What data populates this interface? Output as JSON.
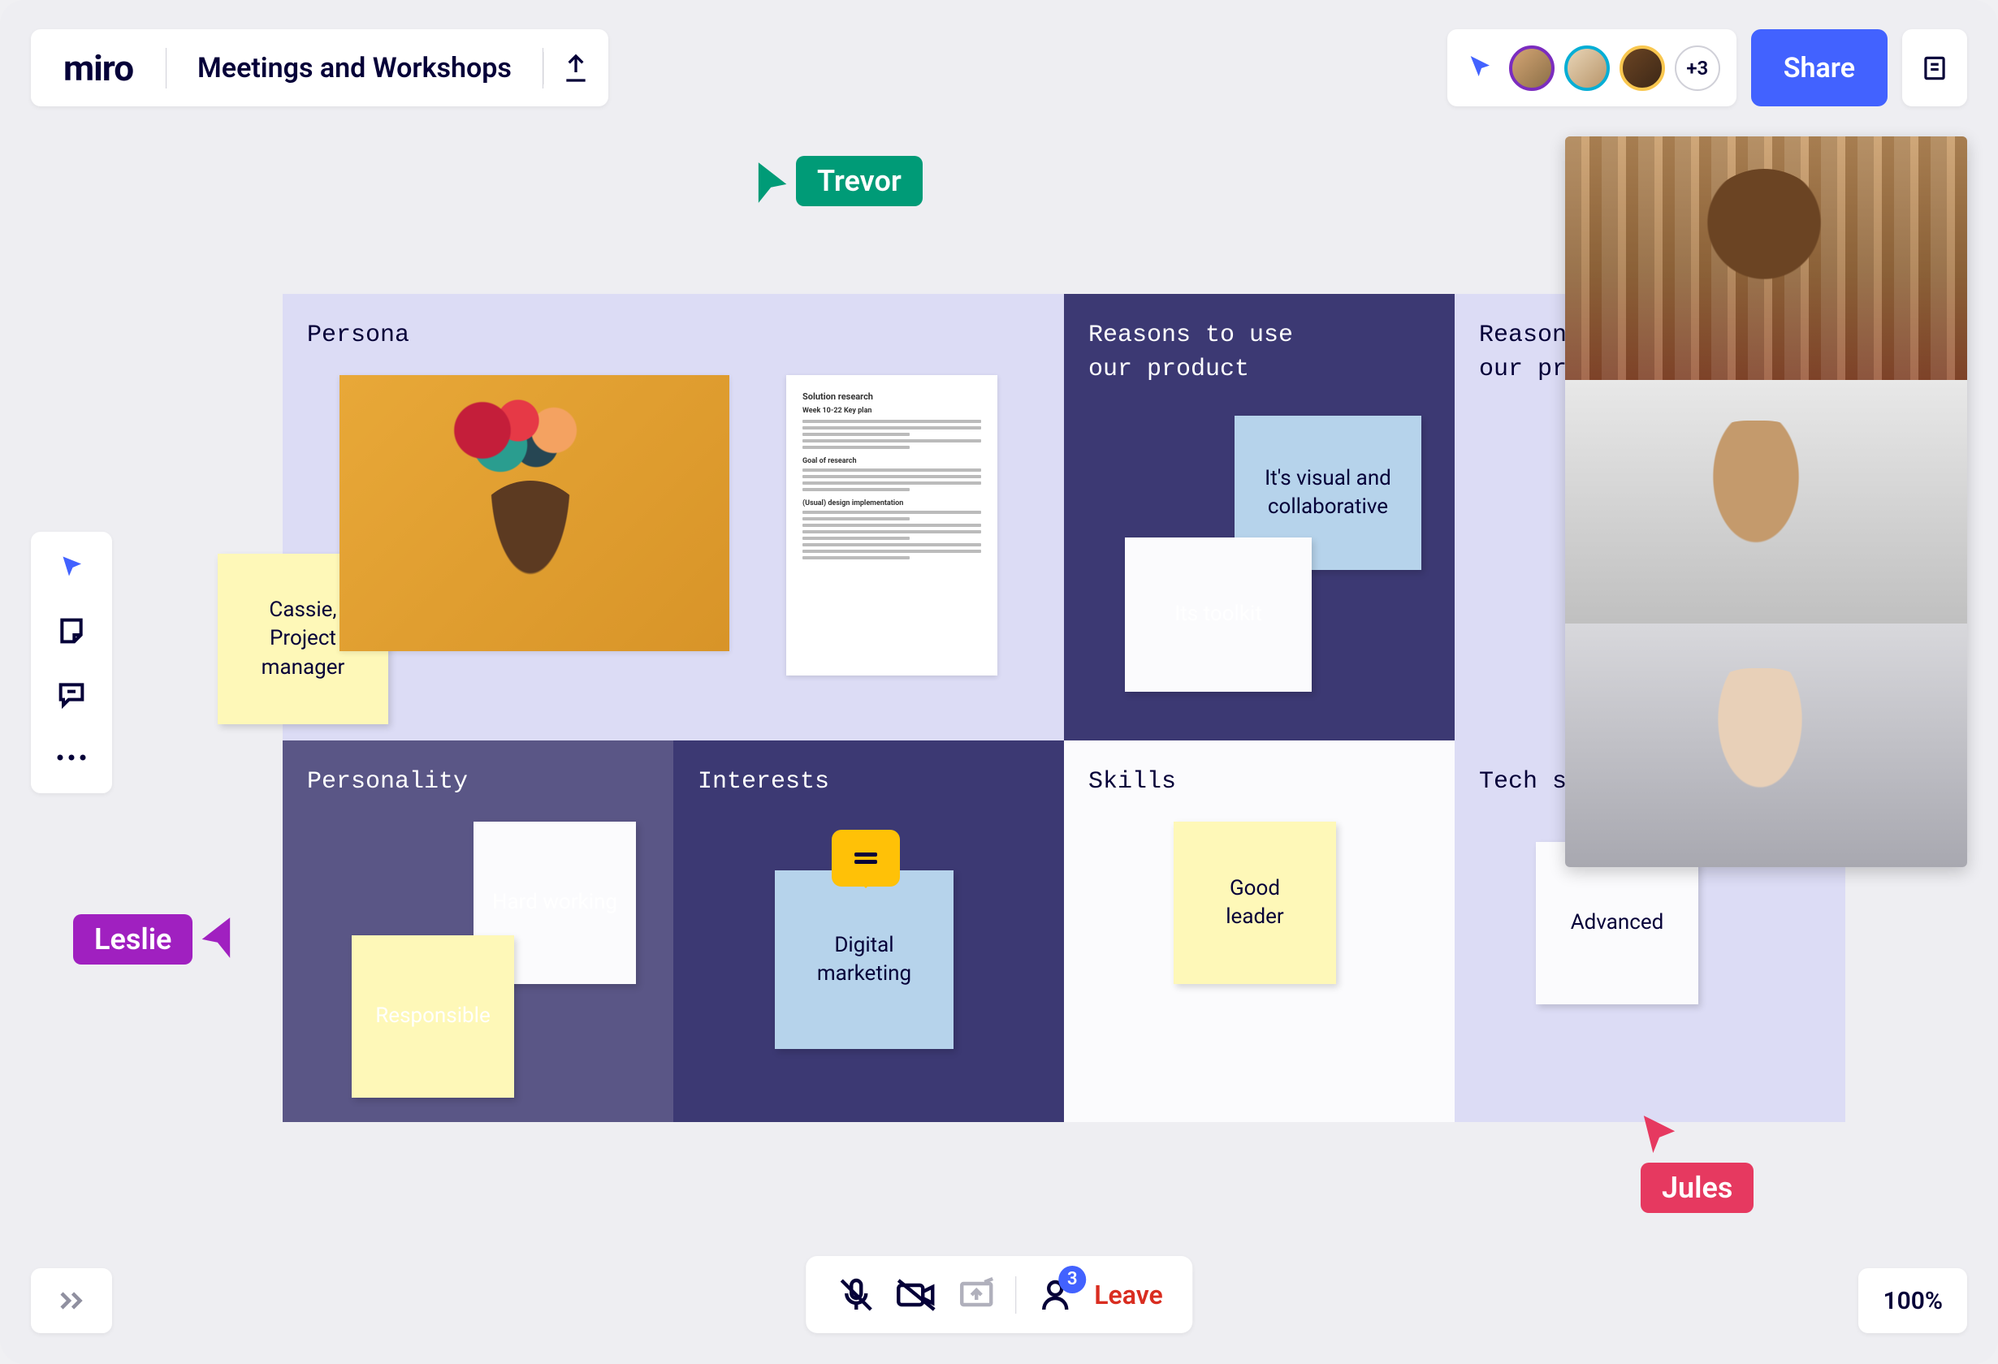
{
  "app": {
    "logo": "miro",
    "board_title": "Meetings and Workshops"
  },
  "collaborators": {
    "overflow": "+3",
    "share": "Share"
  },
  "cursors": {
    "trevor": "Trevor",
    "leslie": "Leslie",
    "jules": "Jules"
  },
  "grid": {
    "persona": {
      "title": "Persona",
      "doc_heading": "Solution research"
    },
    "reasons1": {
      "title": "Reasons to use\nour product"
    },
    "reasons2": {
      "title": "Reasons to use\nour product"
    },
    "personality": {
      "title": "Personality"
    },
    "interests": {
      "title": "Interests"
    },
    "skills": {
      "title": "Skills"
    },
    "tech": {
      "title": "Tech savviness"
    }
  },
  "notes": {
    "cassie": "Cassie,\nProject\nmanager",
    "visual": "It's visual and\ncollaborative",
    "toolkit": "Its toolkit",
    "hardworking": "Hard working",
    "responsible": "Responsible",
    "digital": "Digital\nmarketing",
    "goodleader": "Good\nleader",
    "advanced": "Advanced"
  },
  "call": {
    "participants_badge": "3",
    "leave": "Leave"
  },
  "zoom": "100%"
}
